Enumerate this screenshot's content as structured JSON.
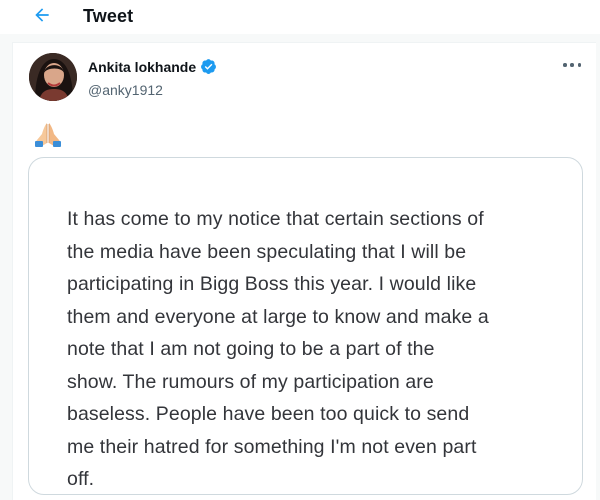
{
  "header": {
    "title": "Tweet",
    "back_icon": "arrow-left-icon"
  },
  "tweet": {
    "author": {
      "name": "Ankita lokhande",
      "handle": "@anky1912",
      "verified_icon": "verified-badge-icon"
    },
    "more_icon": "more-horizontal-icon",
    "text_emoji": "folded-hands-emoji",
    "media": {
      "text_lines": [
        "It has come to my notice that certain sections of",
        "the media have been speculating that I will be",
        "participating in Bigg Boss this year. I would like",
        "them and everyone at large to know and make a",
        "note that I am not going to be a part of the",
        "show. The rumours of my participation are",
        "baseless. People have been too quick to send",
        "me their hatred for something I'm not even part",
        "off."
      ]
    }
  },
  "colors": {
    "accent": "#1d9bf0",
    "text_primary": "#0f1419",
    "text_secondary": "#536471",
    "border": "#cfd9de"
  }
}
